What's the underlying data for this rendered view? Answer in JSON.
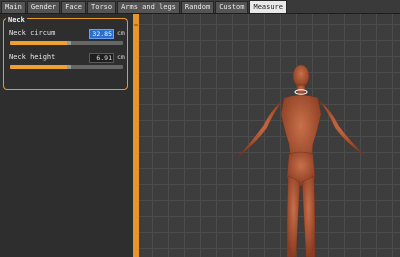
{
  "tabs": [
    {
      "label": "Main",
      "active": false
    },
    {
      "label": "Gender",
      "active": false
    },
    {
      "label": "Face",
      "active": false
    },
    {
      "label": "Torso",
      "active": false
    },
    {
      "label": "Arms and legs",
      "active": false
    },
    {
      "label": "Random",
      "active": false
    },
    {
      "label": "Custom",
      "active": false
    },
    {
      "label": "Measure",
      "active": true
    }
  ],
  "neck_group": {
    "title": "Neck",
    "neck_circum": {
      "label": "Neck circum",
      "value": "32.85",
      "unit": "cm",
      "slider_fraction": 0.5
    },
    "neck_height": {
      "label": "Neck height",
      "value": "6.91",
      "unit": "cm",
      "slider_fraction": 0.5
    }
  },
  "colors": {
    "accent": "#e8962c",
    "selection": "#2d6fd0",
    "skin": "#b35a3a",
    "viewport_bg": "#3d3d3d"
  },
  "viewport": {
    "model": "human-figure-icon",
    "measure_marker": "neck-measure-ring"
  }
}
